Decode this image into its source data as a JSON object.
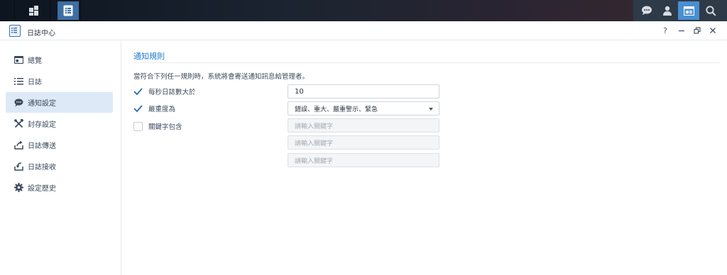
{
  "window": {
    "title": "日誌中心",
    "help_label": "?"
  },
  "sidebar": {
    "items": [
      {
        "label": "總覽",
        "icon": "overview-icon"
      },
      {
        "label": "日誌",
        "icon": "list-icon"
      },
      {
        "label": "通知設定",
        "icon": "chat-bubble-icon",
        "active": true
      },
      {
        "label": "封存設定",
        "icon": "tools-icon"
      },
      {
        "label": "日誌傳送",
        "icon": "upload-icon"
      },
      {
        "label": "日誌接收",
        "icon": "download-icon"
      },
      {
        "label": "設定歷史",
        "icon": "gear-icon"
      }
    ]
  },
  "main": {
    "section_title": "通知規則",
    "description": "當符合下列任一規則時，系統將會寄送通知訊息給管理者。",
    "rules": [
      {
        "label": "每秒日誌數大於",
        "checked": true,
        "value": "10"
      },
      {
        "label": "嚴重度為",
        "checked": true,
        "value": "錯誤、重大、嚴重警示、緊急"
      },
      {
        "label": "關鍵字包含",
        "checked": false
      }
    ],
    "keyword_placeholders": [
      "請輸入關鍵字",
      "請輸入關鍵字",
      "請輸入關鍵字"
    ]
  },
  "colors": {
    "accent": "#1f7dd0",
    "active_nav_bg": "#dde9f6",
    "check": "#2b6cb0"
  }
}
